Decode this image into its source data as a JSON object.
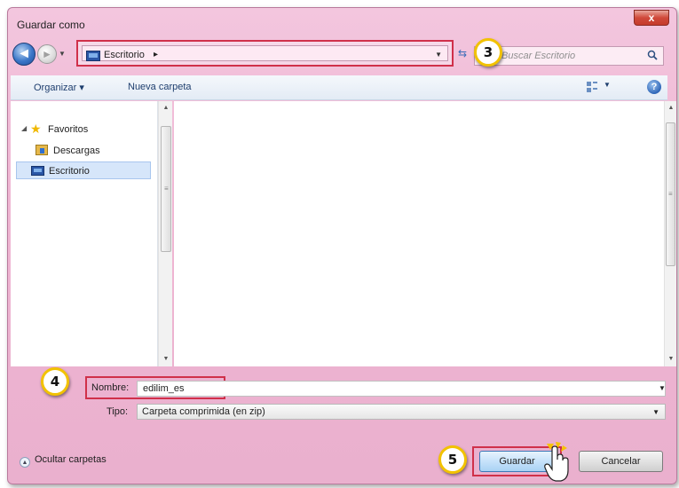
{
  "window": {
    "title": "Guardar como",
    "close_symbol": "x"
  },
  "navigation": {
    "back_symbol": "◄",
    "forward_symbol": "►",
    "breadcrumb": [
      "Escritorio"
    ],
    "breadcrumb_separator": "▸",
    "search_placeholder": "Buscar Escritorio"
  },
  "toolbar": {
    "organize_label": "Organizar ▾",
    "new_folder_label": "Nueva carpeta",
    "help_symbol": "?"
  },
  "nav_pane": {
    "favorites_label": "Favoritos",
    "items": [
      {
        "label": "Descargas",
        "icon": "downloads-folder-icon"
      },
      {
        "label": "Escritorio",
        "icon": "desktop-icon",
        "selected": true
      }
    ]
  },
  "form": {
    "filename_label": "Nombre:",
    "filename_value": "edilim_es",
    "type_label": "Tipo:",
    "type_value": "Carpeta comprimida (en zip)"
  },
  "footer": {
    "hide_folders_label": "Ocultar carpetas",
    "save_label": "Guardar",
    "cancel_label": "Cancelar"
  },
  "annotations": {
    "step_3": "3",
    "step_4": "4",
    "step_5": "5"
  },
  "colors": {
    "highlight_red": "#d0304a",
    "badge_yellow": "#f2c200",
    "window_pink": "#efb6d3"
  }
}
